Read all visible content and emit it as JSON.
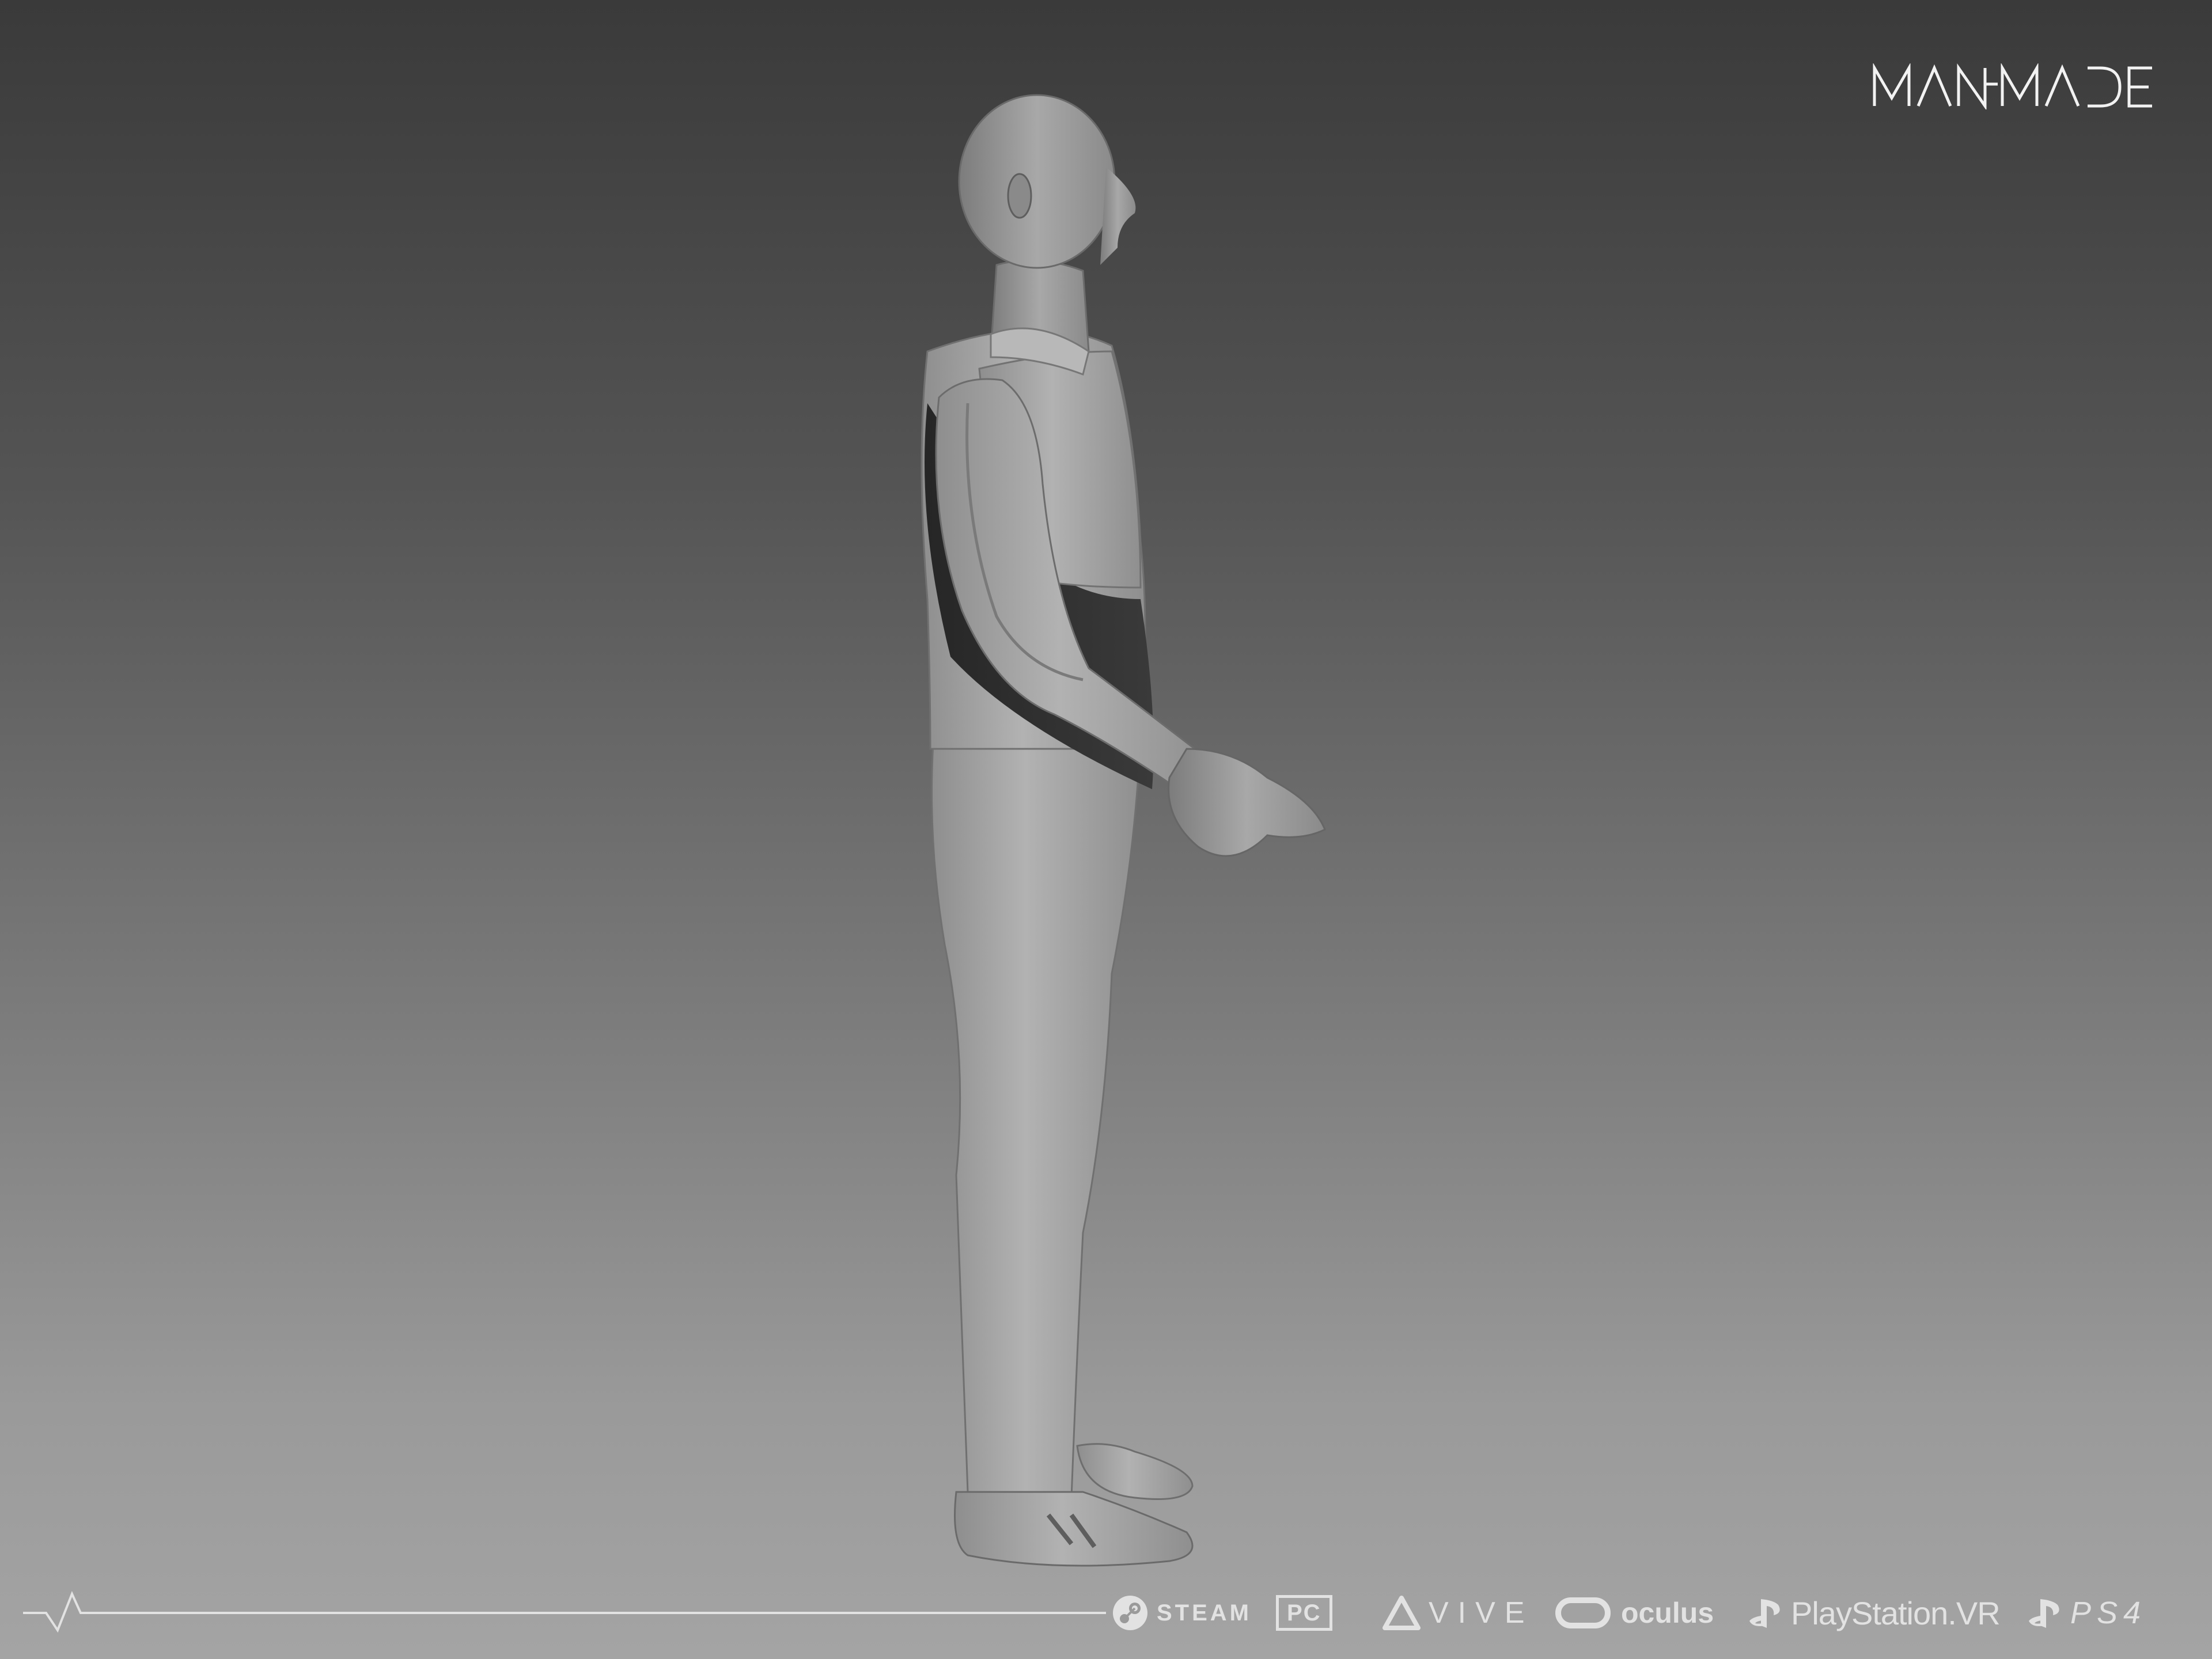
{
  "brand": {
    "logo_text": "MANMADE",
    "logo_icon": "manmade-wordmark-logo"
  },
  "figure": {
    "icon": "male-3d-character-sculpt"
  },
  "footer": {
    "pulse_icon": "heartbeat-pulse-line",
    "platforms": [
      {
        "icon": "steam-icon",
        "label": "STEAM"
      },
      {
        "icon": "pc-icon",
        "label": "PC"
      },
      {
        "icon": "vive-icon",
        "label": "VIVE"
      },
      {
        "icon": "oculus-icon",
        "label": "oculus"
      },
      {
        "icon": "playstation-icon",
        "label": "PlayStation.VR"
      },
      {
        "icon": "playstation-icon",
        "label": "PS4"
      }
    ]
  },
  "colors": {
    "footer_text": "#e2e2e2",
    "figure_base": "#9e9e9e"
  }
}
